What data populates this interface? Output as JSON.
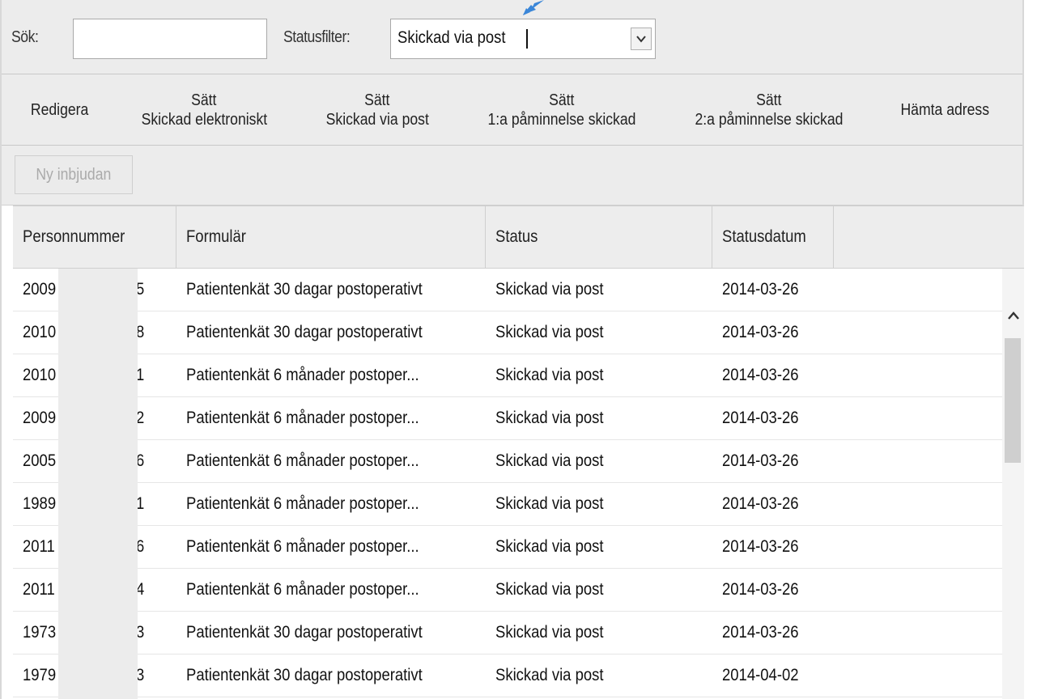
{
  "filter": {
    "search_label": "Sök:",
    "search_value": "",
    "status_label": "Statusfilter:",
    "status_selected": "Skickad via post"
  },
  "actions": [
    {
      "line1": "Redigera",
      "line2": ""
    },
    {
      "line1": "Sätt",
      "line2": "Skickad elektroniskt"
    },
    {
      "line1": "Sätt",
      "line2": "Skickad via post"
    },
    {
      "line1": "Sätt",
      "line2": "1:a påminnelse skickad"
    },
    {
      "line1": "Sätt",
      "line2": "2:a påminnelse skickad"
    },
    {
      "line1": "Hämta adress",
      "line2": ""
    }
  ],
  "toolbar": {
    "new_invite_label": "Ny inbjudan"
  },
  "table": {
    "headers": [
      "Personnummer",
      "Formulär",
      "Status",
      "Statusdatum"
    ],
    "rows": [
      {
        "pnr_start": "2009",
        "pnr_end": "5",
        "form": "Patientenkät 30 dagar postoperativt",
        "status": "Skickad via post",
        "date": "2014-03-26"
      },
      {
        "pnr_start": "2010",
        "pnr_end": "8",
        "form": "Patientenkät 30 dagar postoperativt",
        "status": "Skickad via post",
        "date": "2014-03-26"
      },
      {
        "pnr_start": "2010",
        "pnr_end": "1",
        "form": "Patientenkät 6 månader postoper...",
        "status": "Skickad via post",
        "date": "2014-03-26"
      },
      {
        "pnr_start": "2009",
        "pnr_end": "2",
        "form": "Patientenkät 6 månader postoper...",
        "status": "Skickad via post",
        "date": "2014-03-26"
      },
      {
        "pnr_start": "2005",
        "pnr_end": "6",
        "form": "Patientenkät 6 månader postoper...",
        "status": "Skickad via post",
        "date": "2014-03-26"
      },
      {
        "pnr_start": "1989",
        "pnr_end": "1",
        "form": "Patientenkät 6 månader postoper...",
        "status": "Skickad via post",
        "date": "2014-03-26"
      },
      {
        "pnr_start": "2011",
        "pnr_end": "6",
        "form": "Patientenkät 6 månader postoper...",
        "status": "Skickad via post",
        "date": "2014-03-26"
      },
      {
        "pnr_start": "2011",
        "pnr_end": "4",
        "form": "Patientenkät 6 månader postoper...",
        "status": "Skickad via post",
        "date": "2014-03-26"
      },
      {
        "pnr_start": "1973",
        "pnr_end": "3",
        "form": "Patientenkät 30 dagar postoperativt",
        "status": "Skickad via post",
        "date": "2014-03-26"
      },
      {
        "pnr_start": "1979",
        "pnr_end": "3",
        "form": "Patientenkät 30 dagar postoperativt",
        "status": "Skickad via post",
        "date": "2014-04-02"
      }
    ]
  },
  "colors": {
    "toolbar_bg": "#ececec",
    "pointer_arrow": "#3a86d8"
  }
}
